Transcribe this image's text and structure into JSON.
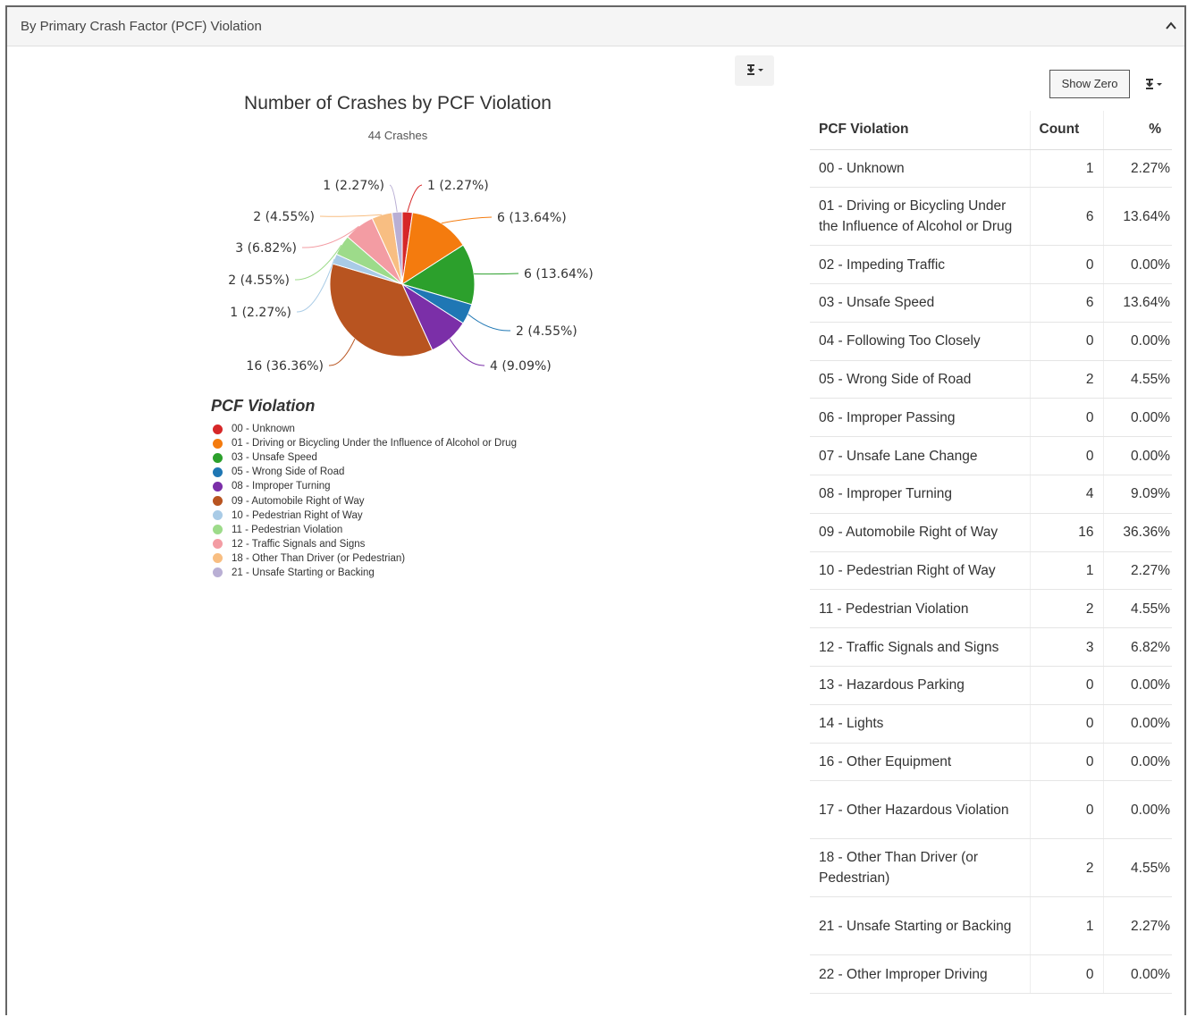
{
  "panel": {
    "title": "By Primary Crash Factor (PCF) Violation"
  },
  "chart": {
    "title": "Number of Crashes by PCF Violation",
    "subtitle": "44 Crashes",
    "legend_title": "PCF Violation"
  },
  "chart_data": {
    "type": "pie",
    "title": "Number of Crashes by PCF Violation",
    "subtitle": "44 Crashes",
    "legend_title": "PCF Violation",
    "legend_position": "below-left",
    "slices": [
      {
        "label": "00 - Unknown",
        "value": 1,
        "percent": "2.27%",
        "color": "#d62728",
        "data_label": "1 (2.27%)"
      },
      {
        "label": "01 - Driving or Bicycling Under the Influence of Alcohol or Drug",
        "value": 6,
        "percent": "13.64%",
        "color": "#f47b0e",
        "data_label": "6 (13.64%)"
      },
      {
        "label": "03 - Unsafe Speed",
        "value": 6,
        "percent": "13.64%",
        "color": "#2ca02c",
        "data_label": "6 (13.64%)"
      },
      {
        "label": "05 - Wrong Side of Road",
        "value": 2,
        "percent": "4.55%",
        "color": "#1f77b4",
        "data_label": "2 (4.55%)"
      },
      {
        "label": "08 - Improper Turning",
        "value": 4,
        "percent": "9.09%",
        "color": "#7b2fa8",
        "data_label": "4 (9.09%)"
      },
      {
        "label": "09 - Automobile Right of Way",
        "value": 16,
        "percent": "36.36%",
        "color": "#b85420",
        "data_label": "16 (36.36%)"
      },
      {
        "label": "10 - Pedestrian Right of Way",
        "value": 1,
        "percent": "2.27%",
        "color": "#a9cbe6",
        "data_label": "1 (2.27%)"
      },
      {
        "label": "11 - Pedestrian Violation",
        "value": 2,
        "percent": "4.55%",
        "color": "#9ddb8a",
        "data_label": "2 (4.55%)"
      },
      {
        "label": "12 - Traffic Signals and Signs",
        "value": 3,
        "percent": "6.82%",
        "color": "#f39ca3",
        "data_label": "3 (6.82%)"
      },
      {
        "label": "18 - Other Than Driver (or Pedestrian)",
        "value": 2,
        "percent": "4.55%",
        "color": "#f8be82",
        "data_label": "2 (4.55%)"
      },
      {
        "label": "21 - Unsafe Starting or Backing",
        "value": 1,
        "percent": "2.27%",
        "color": "#b9afd4",
        "data_label": "1 (2.27%)"
      }
    ]
  },
  "legend": [
    {
      "label": "00 - Unknown",
      "color": "#d62728"
    },
    {
      "label": "01 - Driving or Bicycling Under the Influence of Alcohol or Drug",
      "color": "#f47b0e"
    },
    {
      "label": "03 - Unsafe Speed",
      "color": "#2ca02c"
    },
    {
      "label": "05 - Wrong Side of Road",
      "color": "#1f77b4"
    },
    {
      "label": "08 - Improper Turning",
      "color": "#7b2fa8"
    },
    {
      "label": "09 - Automobile Right of Way",
      "color": "#b85420"
    },
    {
      "label": "10 - Pedestrian Right of Way",
      "color": "#a9cbe6"
    },
    {
      "label": "11 - Pedestrian Violation",
      "color": "#9ddb8a"
    },
    {
      "label": "12 - Traffic Signals and Signs",
      "color": "#f39ca3"
    },
    {
      "label": "18 - Other Than Driver (or Pedestrian)",
      "color": "#f8be82"
    },
    {
      "label": "21 - Unsafe Starting or Backing",
      "color": "#b9afd4"
    }
  ],
  "controls": {
    "show_zero_label": "Show Zero",
    "export_icon": "download-icon",
    "collapse_icon": "chevron-up-icon"
  },
  "table": {
    "headers": {
      "violation": "PCF Violation",
      "count": "Count",
      "percent": "%"
    },
    "rows": [
      {
        "name": "00 - Unknown",
        "count": "1",
        "percent": "2.27%"
      },
      {
        "name": "01 - Driving or Bicycling Under the Influence of Alcohol or Drug",
        "count": "6",
        "percent": "13.64%"
      },
      {
        "name": "02 - Impeding Traffic",
        "count": "0",
        "percent": "0.00%"
      },
      {
        "name": "03 - Unsafe Speed",
        "count": "6",
        "percent": "13.64%"
      },
      {
        "name": "04 - Following Too Closely",
        "count": "0",
        "percent": "0.00%"
      },
      {
        "name": "05 - Wrong Side of Road",
        "count": "2",
        "percent": "4.55%"
      },
      {
        "name": "06 - Improper Passing",
        "count": "0",
        "percent": "0.00%"
      },
      {
        "name": "07 - Unsafe Lane Change",
        "count": "0",
        "percent": "0.00%"
      },
      {
        "name": "08 - Improper Turning",
        "count": "4",
        "percent": "9.09%"
      },
      {
        "name": "09 - Automobile Right of Way",
        "count": "16",
        "percent": "36.36%"
      },
      {
        "name": "10 - Pedestrian Right of Way",
        "count": "1",
        "percent": "2.27%"
      },
      {
        "name": "11 - Pedestrian Violation",
        "count": "2",
        "percent": "4.55%"
      },
      {
        "name": "12 - Traffic Signals and Signs",
        "count": "3",
        "percent": "6.82%"
      },
      {
        "name": "13 - Hazardous Parking",
        "count": "0",
        "percent": "0.00%"
      },
      {
        "name": "14 - Lights",
        "count": "0",
        "percent": "0.00%"
      },
      {
        "name": "16 - Other Equipment",
        "count": "0",
        "percent": "0.00%"
      },
      {
        "name": "17 - Other Hazardous Violation",
        "count": "0",
        "percent": "0.00%"
      },
      {
        "name": "18 - Other Than Driver (or Pedestrian)",
        "count": "2",
        "percent": "4.55%"
      },
      {
        "name": "21 - Unsafe Starting or Backing",
        "count": "1",
        "percent": "2.27%"
      },
      {
        "name": "22 - Other Improper Driving",
        "count": "0",
        "percent": "0.00%"
      }
    ]
  }
}
